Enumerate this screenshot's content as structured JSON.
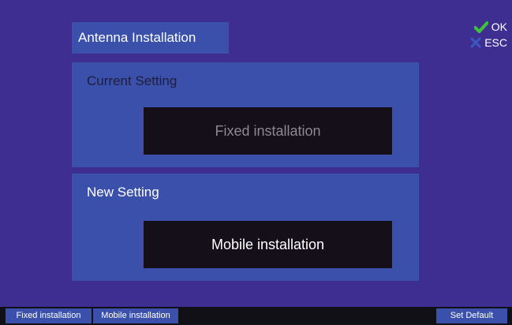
{
  "header": {
    "title": "Antenna Installation"
  },
  "key_hints": {
    "ok_label": "OK",
    "esc_label": "ESC",
    "ok_color": "#3ec43a",
    "esc_color": "#3c58c0"
  },
  "current_setting": {
    "label": "Current Setting",
    "value": "Fixed installation"
  },
  "new_setting": {
    "label": "New Setting",
    "value": "Mobile installation"
  },
  "softkeys": {
    "fixed": "Fixed installation",
    "mobile": "Mobile installation",
    "set_default": "Set Default"
  },
  "colors": {
    "background": "#3f2e91",
    "panel": "#3b50aa",
    "value_box": "#140f18",
    "softkey_bar": "#111016"
  }
}
